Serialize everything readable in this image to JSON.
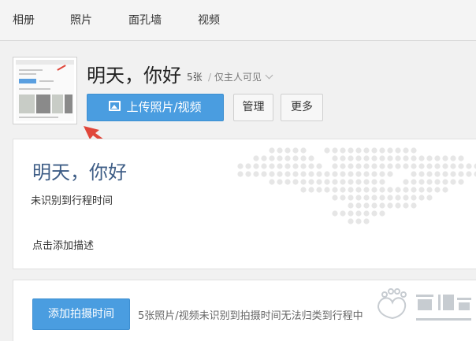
{
  "nav": {
    "tabs": [
      "相册",
      "照片",
      "面孔墙",
      "视频"
    ]
  },
  "album": {
    "title": "明天，你好",
    "count": "5张",
    "visibility": "仅主人可见",
    "upload_label": "上传照片/视频",
    "manage_label": "管理",
    "more_label": "更多"
  },
  "info": {
    "title": "明天，你好",
    "trip_time": "未识别到行程时间",
    "add_description": "点击添加描述"
  },
  "timeline": {
    "add_time_label": "添加拍摄时间",
    "hint": "5张照片/视频未识别到拍摄时间无法归类到行程中"
  },
  "colors": {
    "primary": "#4a9de0",
    "title_blue": "#3e5d86",
    "annotation_red": "#e0463a"
  }
}
